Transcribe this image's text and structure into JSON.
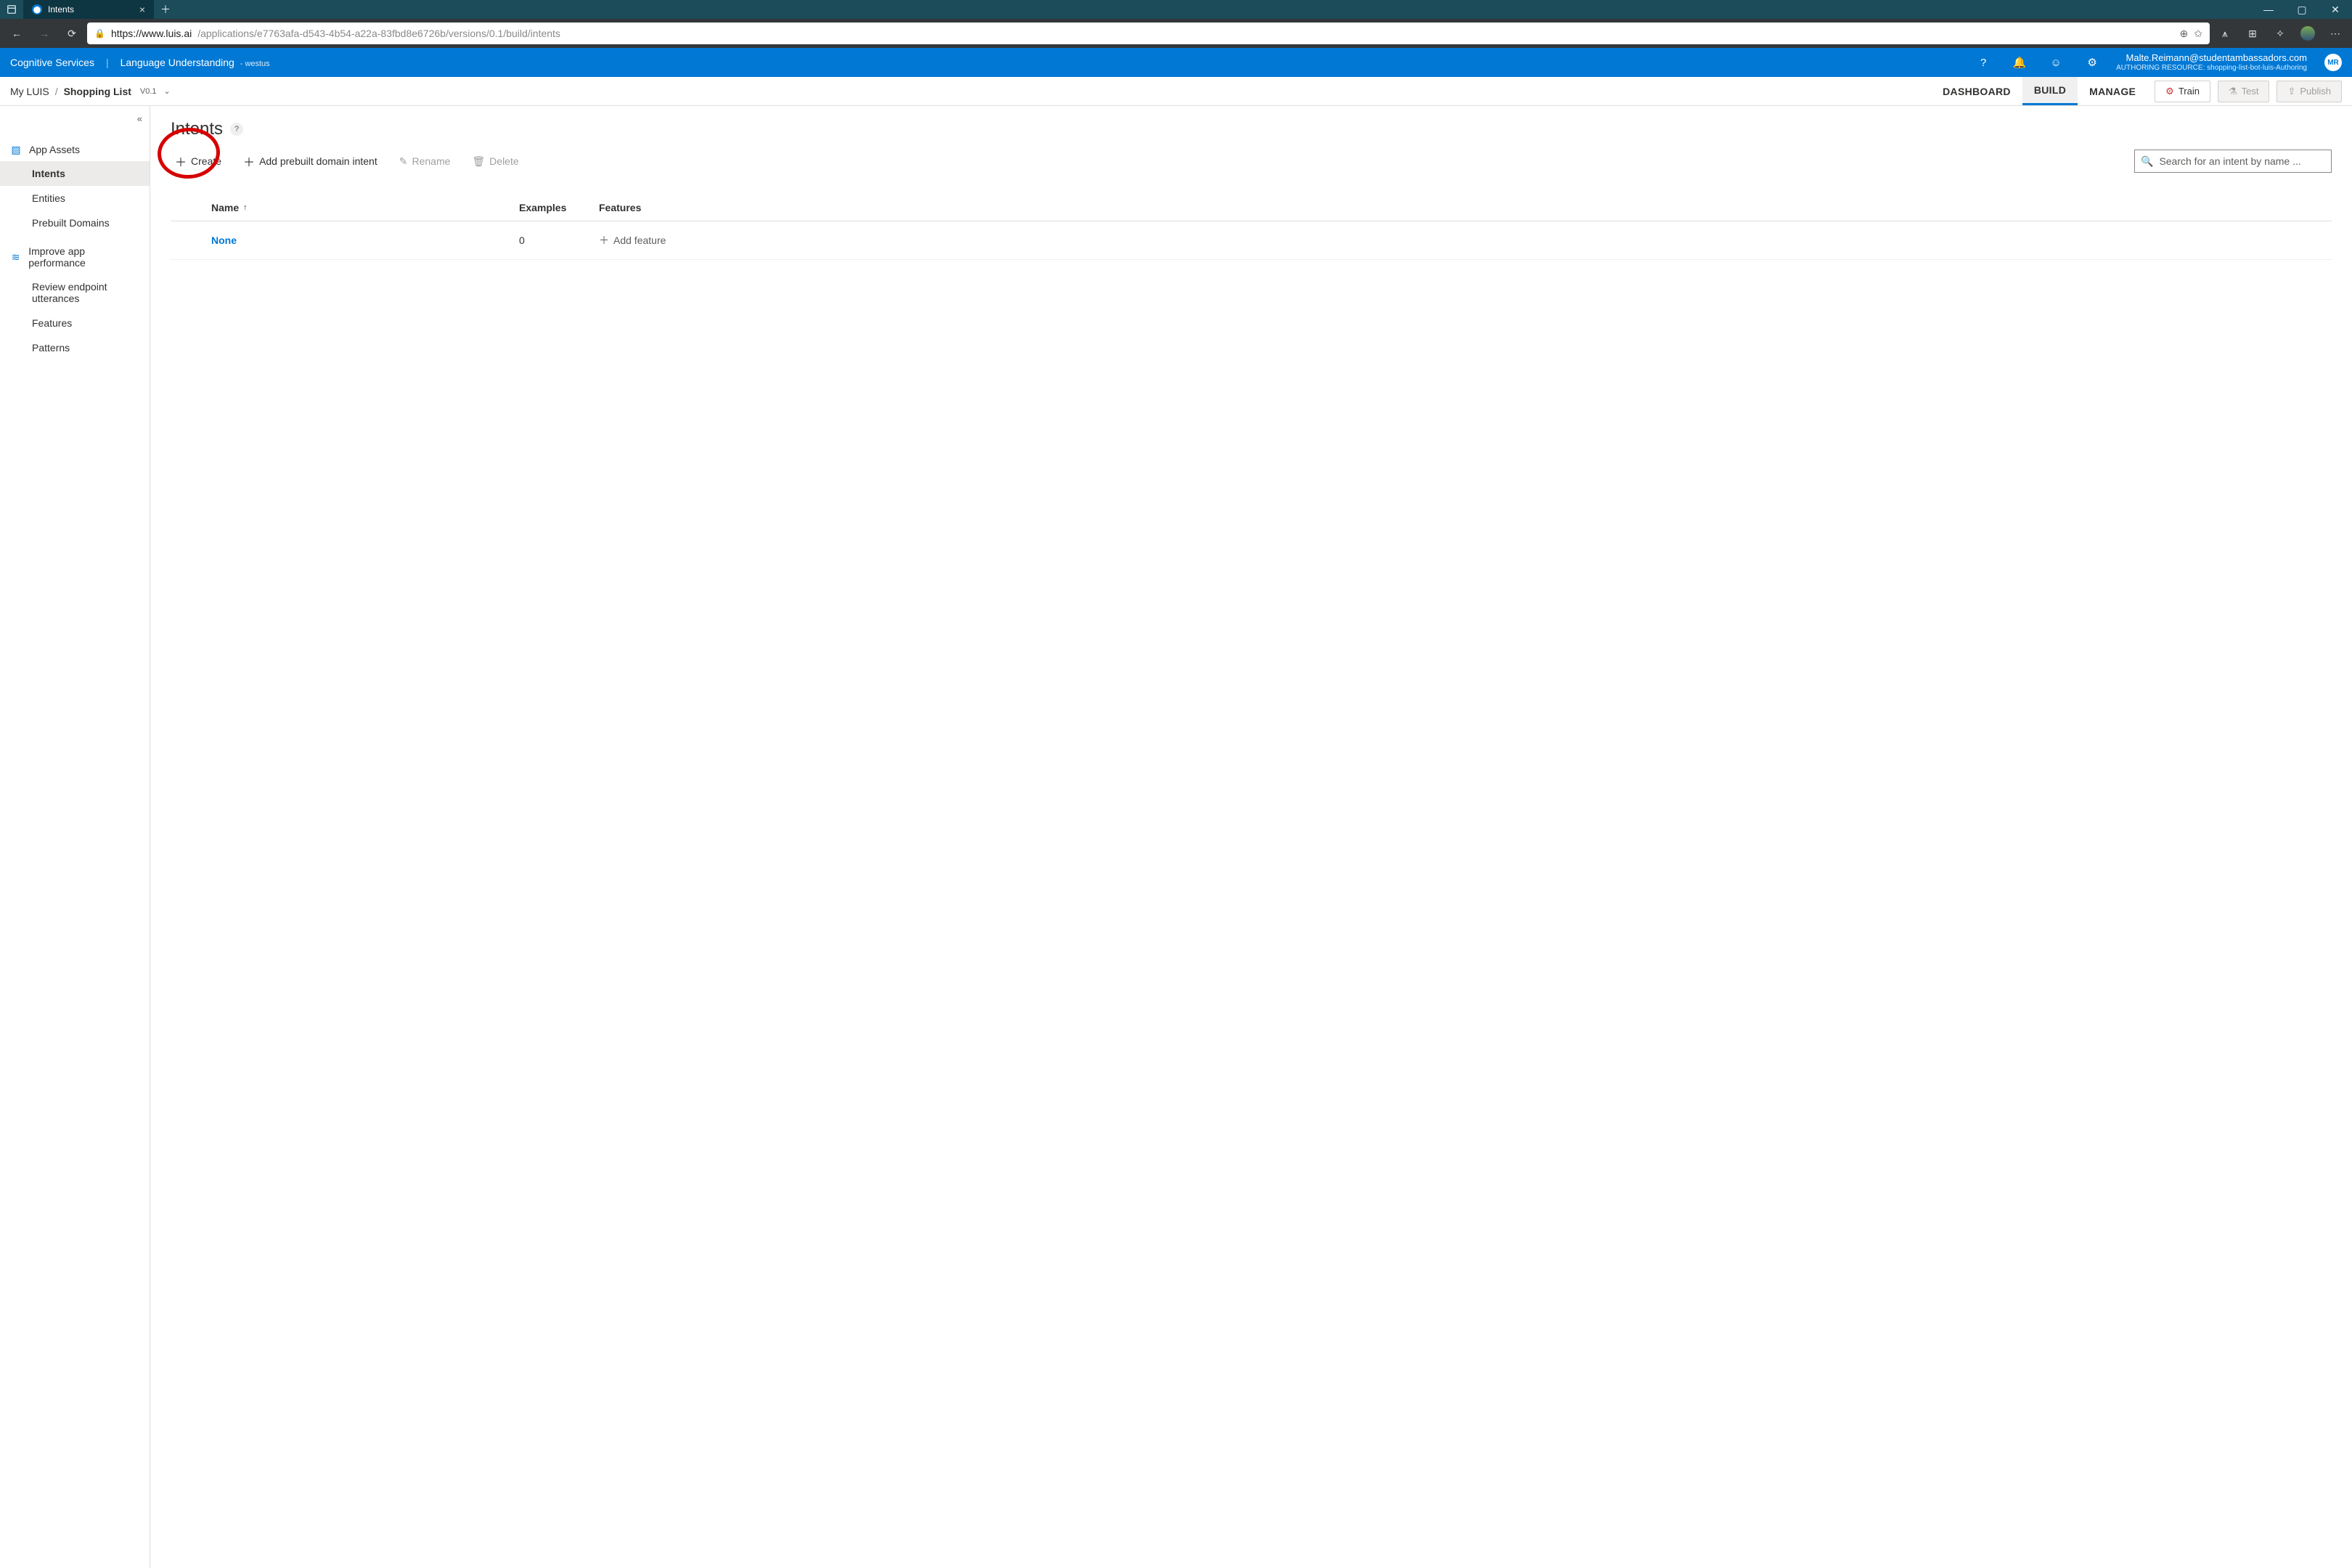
{
  "browser": {
    "tab_title": "Intents",
    "url_host": "https://www.luis.ai",
    "url_path": "/applications/e7763afa-d543-4b54-a22a-83fbd8e6726b/versions/0.1/build/intents"
  },
  "azure_header": {
    "service": "Cognitive Services",
    "product": "Language Understanding",
    "region": "- westus",
    "user_email": "Malte.Reimann@studentambassadors.com",
    "resource_label": "AUTHORING RESOURCE:",
    "resource_value": "shopping-list-bot-luis-Authoring",
    "avatar_initials": "MR"
  },
  "breadcrumb": {
    "root": "My LUIS",
    "current": "Shopping List",
    "version": "V0.1"
  },
  "top_tabs": {
    "dashboard": "DASHBOARD",
    "build": "BUILD",
    "manage": "MANAGE"
  },
  "action_buttons": {
    "train": "Train",
    "test": "Test",
    "publish": "Publish"
  },
  "sidebar": {
    "group1": "App Assets",
    "items1": [
      "Intents",
      "Entities",
      "Prebuilt Domains"
    ],
    "group2": "Improve app performance",
    "items2": [
      "Review endpoint utterances",
      "Features",
      "Patterns"
    ]
  },
  "page": {
    "title": "Intents",
    "toolbar": {
      "create": "Create",
      "add_prebuilt": "Add prebuilt domain intent",
      "rename": "Rename",
      "delete": "Delete"
    },
    "search_placeholder": "Search for an intent by name ...",
    "columns": {
      "name": "Name",
      "examples": "Examples",
      "features": "Features"
    },
    "rows": [
      {
        "name": "None",
        "examples": "0",
        "add_feature": "Add feature"
      }
    ]
  }
}
